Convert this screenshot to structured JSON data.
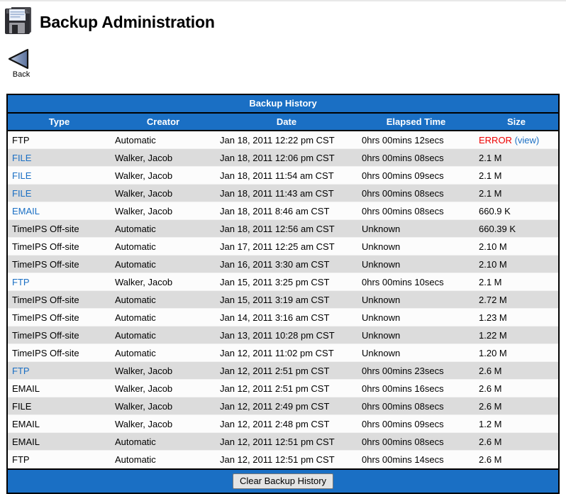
{
  "header": {
    "title": "Backup Administration",
    "icon": "floppy-disk-icon"
  },
  "back": {
    "label": "Back",
    "icon": "back-arrow-icon"
  },
  "panel": {
    "title": "Backup History",
    "columns": [
      "Type",
      "Creator",
      "Date",
      "Elapsed Time",
      "Size"
    ],
    "footer_button": "Clear Backup History"
  },
  "colors": {
    "accent_blue": "#1a6fc4",
    "link_blue": "#1a6fc4",
    "error_red": "#ee0000",
    "row_odd": "#fcfcfc",
    "row_even": "#dcdcdc"
  },
  "rows": [
    {
      "type": "FTP",
      "type_link": false,
      "creator": "Automatic",
      "date": "Jan 18, 2011 12:22 pm CST",
      "elapsed": "0hrs 00mins 12secs",
      "size": "ERROR",
      "size_error": true,
      "size_view": "(view)"
    },
    {
      "type": "FILE",
      "type_link": true,
      "creator": "Walker, Jacob",
      "date": "Jan 18, 2011 12:06 pm CST",
      "elapsed": "0hrs 00mins 08secs",
      "size": "2.1 M"
    },
    {
      "type": "FILE",
      "type_link": true,
      "creator": "Walker, Jacob",
      "date": "Jan 18, 2011 11:54 am CST",
      "elapsed": "0hrs 00mins 09secs",
      "size": "2.1 M"
    },
    {
      "type": "FILE",
      "type_link": true,
      "creator": "Walker, Jacob",
      "date": "Jan 18, 2011 11:43 am CST",
      "elapsed": "0hrs 00mins 08secs",
      "size": "2.1 M"
    },
    {
      "type": "EMAIL",
      "type_link": true,
      "creator": "Walker, Jacob",
      "date": "Jan 18, 2011 8:46 am CST",
      "elapsed": "0hrs 00mins 08secs",
      "size": "660.9 K"
    },
    {
      "type": "TimeIPS Off-site",
      "type_link": false,
      "creator": "Automatic",
      "date": "Jan 18, 2011 12:56 am CST",
      "elapsed": "Unknown",
      "size": "660.39 K"
    },
    {
      "type": "TimeIPS Off-site",
      "type_link": false,
      "creator": "Automatic",
      "date": "Jan 17, 2011 12:25 am CST",
      "elapsed": "Unknown",
      "size": "2.10 M"
    },
    {
      "type": "TimeIPS Off-site",
      "type_link": false,
      "creator": "Automatic",
      "date": "Jan 16, 2011 3:30 am CST",
      "elapsed": "Unknown",
      "size": "2.10 M"
    },
    {
      "type": "FTP",
      "type_link": true,
      "creator": "Walker, Jacob",
      "date": "Jan 15, 2011 3:25 pm CST",
      "elapsed": "0hrs 00mins 10secs",
      "size": "2.1 M"
    },
    {
      "type": "TimeIPS Off-site",
      "type_link": false,
      "creator": "Automatic",
      "date": "Jan 15, 2011 3:19 am CST",
      "elapsed": "Unknown",
      "size": "2.72 M"
    },
    {
      "type": "TimeIPS Off-site",
      "type_link": false,
      "creator": "Automatic",
      "date": "Jan 14, 2011 3:16 am CST",
      "elapsed": "Unknown",
      "size": "1.23 M"
    },
    {
      "type": "TimeIPS Off-site",
      "type_link": false,
      "creator": "Automatic",
      "date": "Jan 13, 2011 10:28 pm CST",
      "elapsed": "Unknown",
      "size": "1.22 M"
    },
    {
      "type": "TimeIPS Off-site",
      "type_link": false,
      "creator": "Automatic",
      "date": "Jan 12, 2011 11:02 pm CST",
      "elapsed": "Unknown",
      "size": "1.20 M"
    },
    {
      "type": "FTP",
      "type_link": true,
      "creator": "Walker, Jacob",
      "date": "Jan 12, 2011 2:51 pm CST",
      "elapsed": "0hrs 00mins 23secs",
      "size": "2.6 M"
    },
    {
      "type": "EMAIL",
      "type_link": false,
      "creator": "Walker, Jacob",
      "date": "Jan 12, 2011 2:51 pm CST",
      "elapsed": "0hrs 00mins 16secs",
      "size": "2.6 M"
    },
    {
      "type": "FILE",
      "type_link": false,
      "creator": "Walker, Jacob",
      "date": "Jan 12, 2011 2:49 pm CST",
      "elapsed": "0hrs 00mins 08secs",
      "size": "2.6 M"
    },
    {
      "type": "EMAIL",
      "type_link": false,
      "creator": "Walker, Jacob",
      "date": "Jan 12, 2011 2:48 pm CST",
      "elapsed": "0hrs 00mins 09secs",
      "size": "1.2 M"
    },
    {
      "type": "EMAIL",
      "type_link": false,
      "creator": "Automatic",
      "date": "Jan 12, 2011 12:51 pm CST",
      "elapsed": "0hrs 00mins 08secs",
      "size": "2.6 M"
    },
    {
      "type": "FTP",
      "type_link": false,
      "creator": "Automatic",
      "date": "Jan 12, 2011 12:51 pm CST",
      "elapsed": "0hrs 00mins 14secs",
      "size": "2.6 M"
    }
  ]
}
